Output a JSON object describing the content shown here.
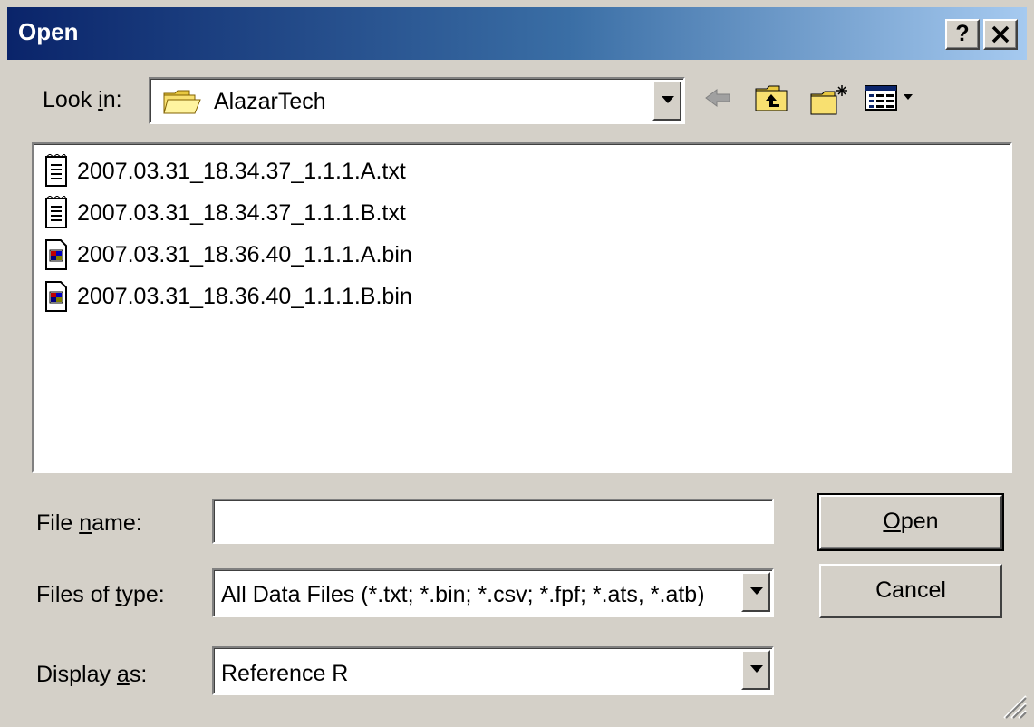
{
  "window": {
    "title": "Open",
    "help_label": "?",
    "close_label": "✕"
  },
  "look_in": {
    "label_pre": "Look ",
    "label_u": "i",
    "label_post": "n:",
    "value": "AlazarTech",
    "icon": "folder-icon"
  },
  "toolbar": {
    "icons": [
      "back-arrow-icon",
      "up-one-level-icon",
      "new-folder-icon",
      "view-menu-icon"
    ]
  },
  "files": [
    {
      "name": "2007.03.31_18.34.37_1.1.1.A.txt",
      "icon": "text-file-icon"
    },
    {
      "name": "2007.03.31_18.34.37_1.1.1.B.txt",
      "icon": "text-file-icon"
    },
    {
      "name": "2007.03.31_18.36.40_1.1.1.A.bin",
      "icon": "bin-file-icon"
    },
    {
      "name": "2007.03.31_18.36.40_1.1.1.B.bin",
      "icon": "bin-file-icon"
    }
  ],
  "file_name": {
    "label_pre": "File ",
    "label_u": "n",
    "label_post": "ame:",
    "value": ""
  },
  "files_of_type": {
    "label_pre": "Files of ",
    "label_u": "t",
    "label_post": "ype:",
    "value": "All Data Files (*.txt; *.bin; *.csv; *.fpf; *.ats, *.atb)"
  },
  "display_as": {
    "label_pre": "Display ",
    "label_u": "a",
    "label_post": "s:",
    "value": "Reference R"
  },
  "buttons": {
    "open_u": "O",
    "open_rest": "pen",
    "cancel": "Cancel"
  }
}
